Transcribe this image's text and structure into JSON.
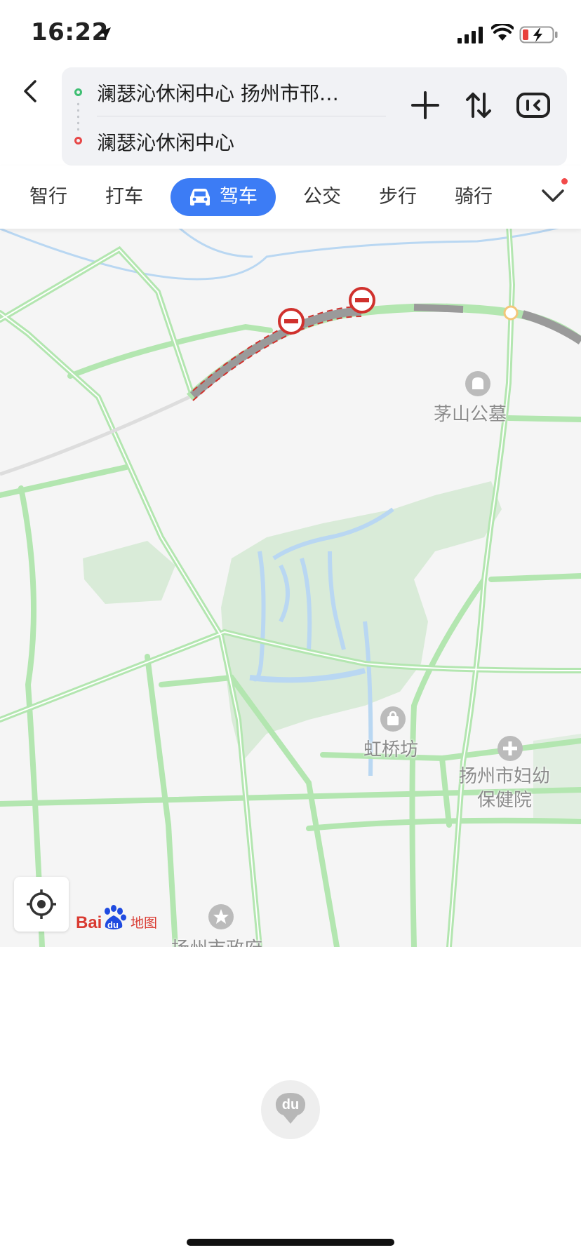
{
  "status_bar": {
    "time": "16:22"
  },
  "route": {
    "start": "澜瑟沁休闲中心 扬州市邗…",
    "end": "澜瑟沁休闲中心"
  },
  "tabs": [
    {
      "label": "智行"
    },
    {
      "label": "打车"
    },
    {
      "label": "驾车",
      "active": true
    },
    {
      "label": "公交"
    },
    {
      "label": "步行"
    },
    {
      "label": "骑行"
    }
  ],
  "map": {
    "pois": [
      {
        "label": "茅山公墓",
        "icon": "cemetery-icon"
      },
      {
        "label": "虹桥坊",
        "icon": "shopping-bag-icon"
      },
      {
        "label": "扬州市妇幼\n保健院",
        "icon": "hospital-icon"
      },
      {
        "label": "扬州市政府",
        "icon": "government-star-icon"
      }
    ],
    "logo_text_latin": "Bai",
    "logo_text_du": "du",
    "logo_text_cn": "地图"
  },
  "loading": {
    "pin_text": "du"
  },
  "colors": {
    "accent": "#3c7cf5",
    "road": "#b3e6b0",
    "congestion": "#9a9a9a",
    "restriction": "#d0312d",
    "water": "#b9d7f2",
    "park": "#d9ebd8"
  }
}
